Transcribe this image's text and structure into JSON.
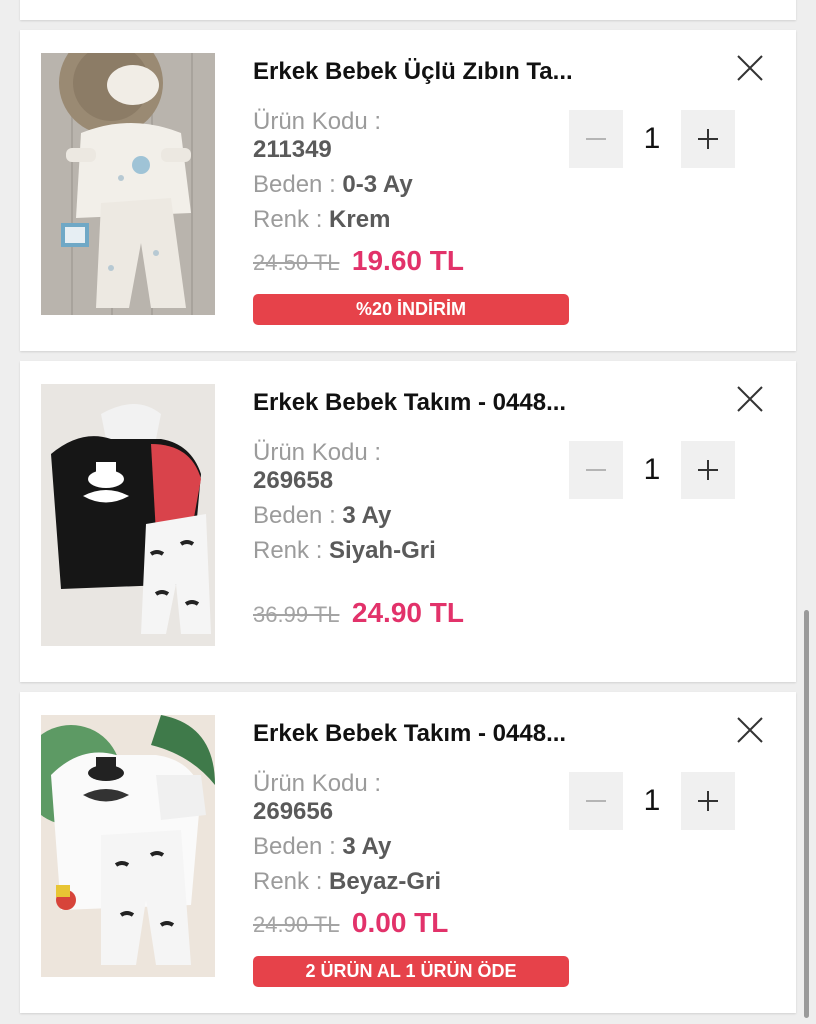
{
  "cart": {
    "items": [
      {
        "title": "Erkek Bebek Üçlü Zıbın Ta...",
        "code_label": "Ürün Kodu :",
        "code": "211349",
        "size_label": "Beden :",
        "size": "0-3 Ay",
        "color_label": "Renk :",
        "color": "Krem",
        "old_price": "24.50 TL",
        "new_price": "19.60 TL",
        "badge": "%20 İNDİRİM",
        "quantity": "1",
        "image_icon": "baby-bodysuit-set-cream-image"
      },
      {
        "title": "Erkek Bebek Takım - 0448...",
        "code_label": "Ürün Kodu :",
        "code": "269658",
        "size_label": "Beden :",
        "size": "3 Ay",
        "color_label": "Renk :",
        "color": "Siyah-Gri",
        "old_price": "36.99 TL",
        "new_price": "24.90 TL",
        "quantity": "1",
        "image_icon": "baby-set-black-mustache-image"
      },
      {
        "title": "Erkek Bebek Takım - 0448...",
        "code_label": "Ürün Kodu :",
        "code": "269656",
        "size_label": "Beden :",
        "size": "3 Ay",
        "color_label": "Renk :",
        "color": "Beyaz-Gri",
        "old_price": "24.90 TL",
        "new_price": "0.00 TL",
        "badge": "2 ÜRÜN AL 1 ÜRÜN ÖDE",
        "quantity": "1",
        "image_icon": "baby-set-white-mustache-image"
      }
    ]
  },
  "icons": {
    "remove": "close-icon",
    "decrease": "minus-icon",
    "increase": "plus-icon"
  },
  "colors": {
    "price": "#e2326a",
    "badge": "#e6424a",
    "old_price": "#a4a4a4",
    "label": "#9b9b9b",
    "value": "#5a5a5a"
  }
}
